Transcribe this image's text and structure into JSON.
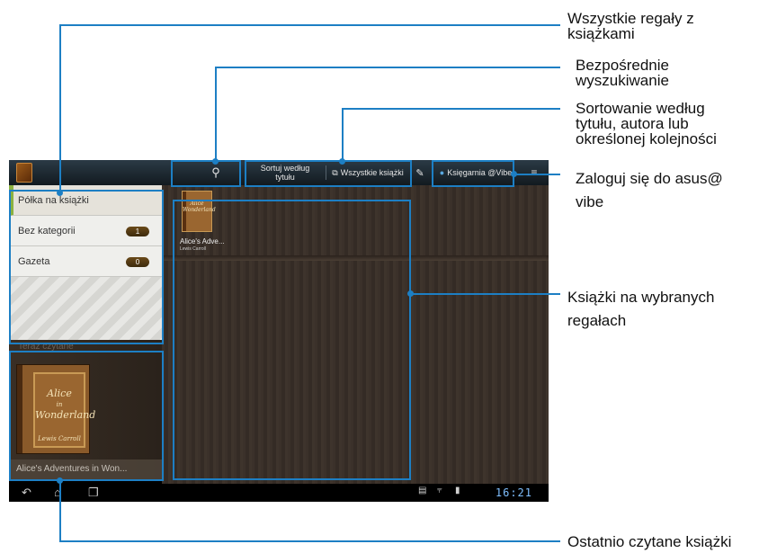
{
  "toolbar": {
    "sort_line1": "Sortuj według",
    "sort_line2": "tytułu",
    "all_books": "Wszystkie książki",
    "store": "Księgarnia @Vibe"
  },
  "shelves": [
    {
      "label": "Półka na książki",
      "count": null
    },
    {
      "label": "Bez kategorii",
      "count": "1"
    },
    {
      "label": "Gazeta",
      "count": "0"
    }
  ],
  "reading": {
    "label": "Teraz czytane",
    "title": "Alice's Adventures in Won...",
    "cover_line1": "Alice",
    "cover_line2": "in",
    "cover_line3": "Wonderland",
    "cover_author": "Lewis Carroll"
  },
  "book": {
    "title": "Alice's Adve...",
    "author": "Lewis Carroll",
    "cover_line1": "Alice",
    "cover_line2": "Wonderland"
  },
  "status": {
    "clock": "16:21"
  },
  "annotations": {
    "all_shelves": [
      "Wszystkie regały z",
      "książkami"
    ],
    "search": [
      "Bezpośrednie",
      "wyszukiwanie"
    ],
    "sort": [
      "Sortowanie według",
      "tytułu, autora lub",
      "określonej kolejności"
    ],
    "login": [
      "Zaloguj się do asus@",
      "vibe"
    ],
    "books_on_shelves": [
      "Książki na wybranych",
      "regałach"
    ],
    "recent": [
      "Ostatnio czytane książki"
    ]
  },
  "colors": {
    "callout": "#1d7fc4",
    "selected_shelf": "#8bb140"
  }
}
